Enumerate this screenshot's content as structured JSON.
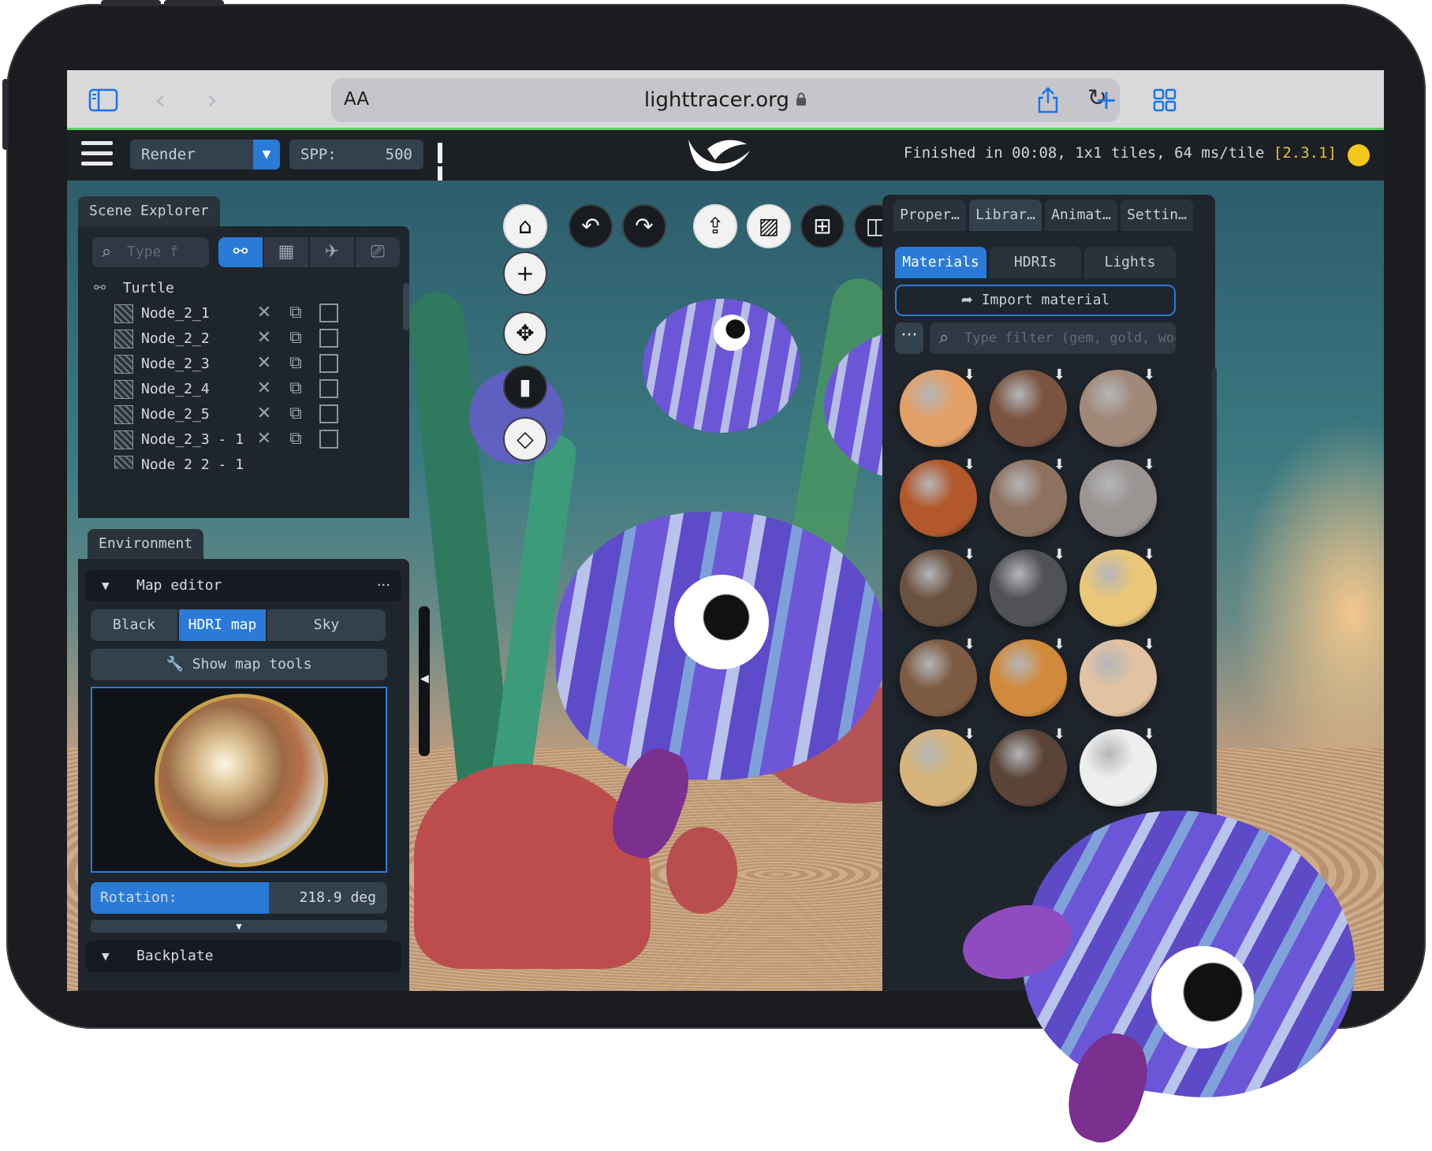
{
  "browser": {
    "text_size_label": "AA",
    "url": "lighttracer.org",
    "reload_glyph": "↻"
  },
  "toolbar": {
    "render_mode": "Render",
    "spp_label": "SPP:",
    "spp_value": "500",
    "status_text": "Finished in 00:08, 1x1 tiles, 64 ms/tile",
    "version": "[2.3.1]",
    "status_dot_color": "#f4c71b"
  },
  "scene_explorer": {
    "tab_label": "Scene Explorer",
    "search_placeholder": "Type f",
    "root_label": "Turtle",
    "nodes": [
      "Node_2_1",
      "Node_2_2",
      "Node_2_3",
      "Node_2_4",
      "Node_2_5",
      "Node_2_3 - 1",
      "Node_2_2 - 1"
    ]
  },
  "environment": {
    "tab_label": "Environment",
    "map_editor_label": "Map editor",
    "more_label": "···",
    "modes": [
      "Black",
      "HDRI map",
      "Sky"
    ],
    "active_mode": "HDRI map",
    "show_map_tools_label": "Show map tools",
    "rotation_label": "Rotation:",
    "rotation_value": "218.9 deg",
    "rotation_fraction": 0.6,
    "backplate_label": "Backplate"
  },
  "right_panel": {
    "tabs": [
      "Proper…",
      "Librar…",
      "Animat…",
      "Settin…"
    ],
    "active_tab": "Librar…",
    "subtabs": [
      "Materials",
      "HDRIs",
      "Lights"
    ],
    "active_subtab": "Materials",
    "import_label": "Import material",
    "more_label": "···",
    "filter_placeholder": "Type filter (gem, gold, woo",
    "material_colors": [
      "#e2a067",
      "#7a5440",
      "#a08878",
      "#b2582a",
      "#8e7260",
      "#9a9492",
      "#6b5240",
      "#505256",
      "#e9c67a",
      "#7d5a42",
      "#d18a3c",
      "#e2c2a2",
      "#d7b57a",
      "#5a4438",
      "#eeeeee"
    ]
  },
  "accent_color": "#2a7bd8"
}
